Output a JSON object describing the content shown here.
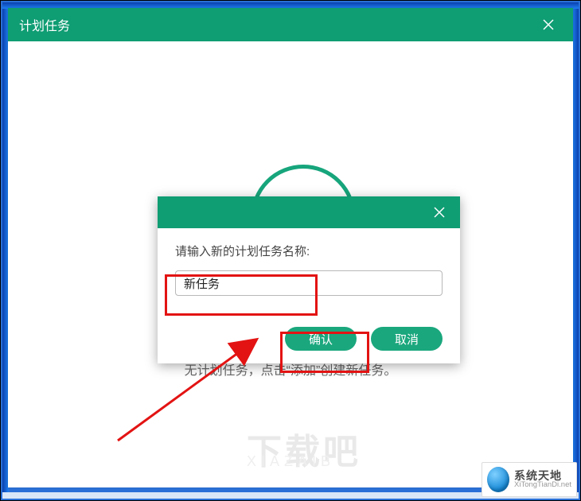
{
  "window": {
    "title": "计划任务",
    "close_icon": "close"
  },
  "empty_state": {
    "text": "无计划任务，点击“添加”创建新任务。"
  },
  "watermark": {
    "line1": "下载吧",
    "line2": "XIAZAIB"
  },
  "modal": {
    "prompt": "请输入新的计划任务名称:",
    "input_value": "新任务",
    "confirm_label": "确认",
    "cancel_label": "取消",
    "close_icon": "close"
  },
  "badge": {
    "title": "系统天地",
    "subtitle": "XiTongTianDi.net"
  }
}
